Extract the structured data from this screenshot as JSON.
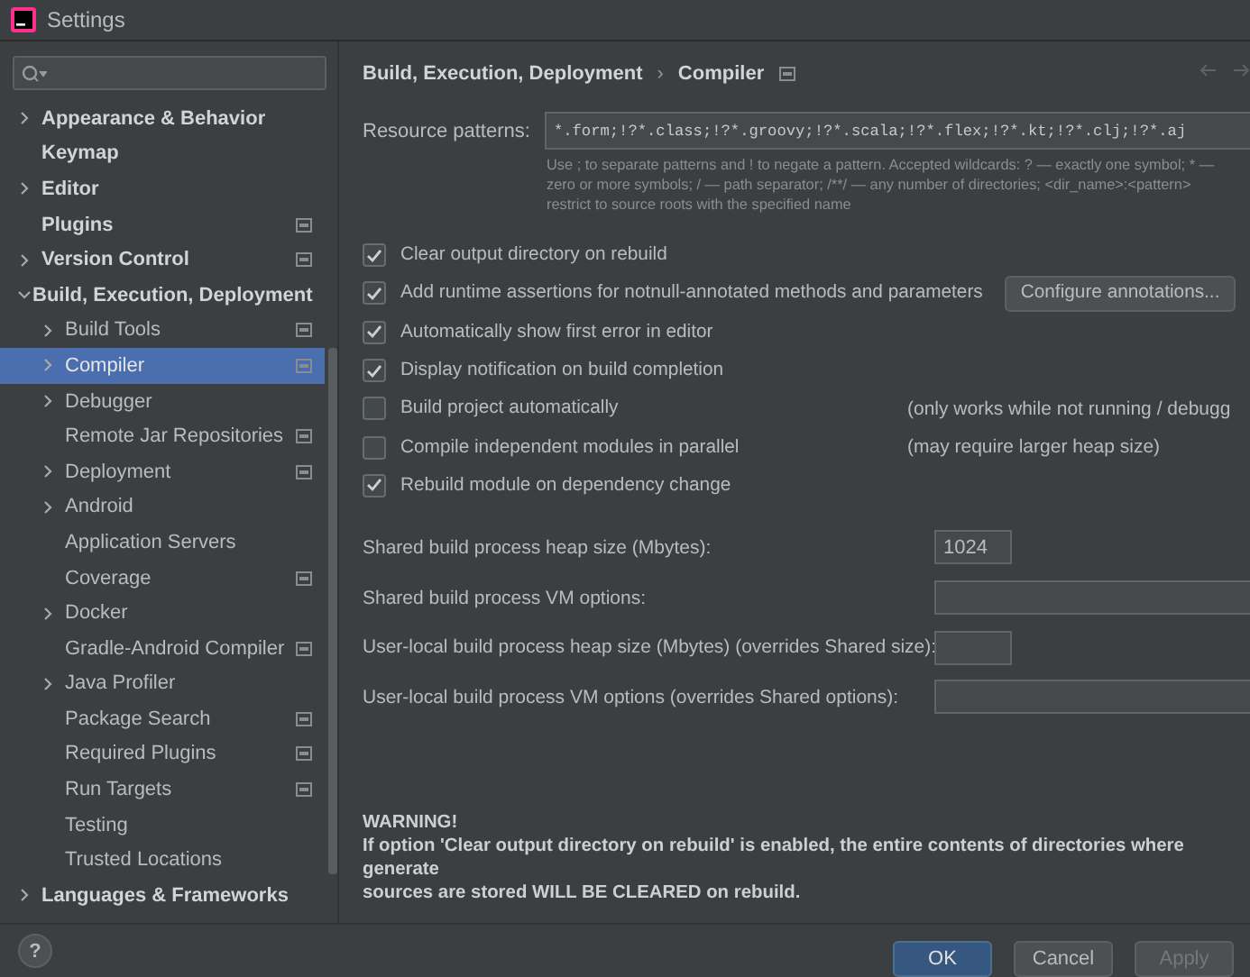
{
  "window": {
    "title": "Settings"
  },
  "sidebar": {
    "items": [
      {
        "label": "Appearance & Behavior",
        "kind": "group",
        "expanded": false,
        "selected": false,
        "scoped": false
      },
      {
        "label": "Keymap",
        "kind": "leaf",
        "selected": false,
        "scoped": false
      },
      {
        "label": "Editor",
        "kind": "group",
        "expanded": false,
        "selected": false,
        "scoped": false
      },
      {
        "label": "Plugins",
        "kind": "leaf",
        "selected": false,
        "scoped": true
      },
      {
        "label": "Version Control",
        "kind": "group",
        "expanded": false,
        "selected": false,
        "scoped": true
      },
      {
        "label": "Build, Execution, Deployment",
        "kind": "group",
        "expanded": true,
        "selected": false,
        "scoped": false,
        "children": [
          {
            "label": "Build Tools",
            "kind": "group",
            "expanded": false,
            "selected": false,
            "scoped": true
          },
          {
            "label": "Compiler",
            "kind": "group",
            "expanded": false,
            "selected": true,
            "scoped": true
          },
          {
            "label": "Debugger",
            "kind": "group",
            "expanded": false,
            "selected": false,
            "scoped": false
          },
          {
            "label": "Remote Jar Repositories",
            "kind": "leaf",
            "selected": false,
            "scoped": true
          },
          {
            "label": "Deployment",
            "kind": "group",
            "expanded": false,
            "selected": false,
            "scoped": true
          },
          {
            "label": "Android",
            "kind": "group",
            "expanded": false,
            "selected": false,
            "scoped": false
          },
          {
            "label": "Application Servers",
            "kind": "leaf",
            "selected": false,
            "scoped": false
          },
          {
            "label": "Coverage",
            "kind": "leaf",
            "selected": false,
            "scoped": true
          },
          {
            "label": "Docker",
            "kind": "group",
            "expanded": false,
            "selected": false,
            "scoped": false
          },
          {
            "label": "Gradle-Android Compiler",
            "kind": "leaf",
            "selected": false,
            "scoped": true
          },
          {
            "label": "Java Profiler",
            "kind": "group",
            "expanded": false,
            "selected": false,
            "scoped": false
          },
          {
            "label": "Package Search",
            "kind": "leaf",
            "selected": false,
            "scoped": true
          },
          {
            "label": "Required Plugins",
            "kind": "leaf",
            "selected": false,
            "scoped": true
          },
          {
            "label": "Run Targets",
            "kind": "leaf",
            "selected": false,
            "scoped": true
          },
          {
            "label": "Testing",
            "kind": "leaf",
            "selected": false,
            "scoped": false
          },
          {
            "label": "Trusted Locations",
            "kind": "leaf",
            "selected": false,
            "scoped": false
          }
        ]
      },
      {
        "label": "Languages & Frameworks",
        "kind": "group",
        "expanded": false,
        "selected": false,
        "scoped": false
      }
    ]
  },
  "breadcrumb": {
    "parent": "Build, Execution, Deployment",
    "separator": "›",
    "current": "Compiler"
  },
  "resource_patterns": {
    "label": "Resource patterns:",
    "value": "*.form;!?*.class;!?*.groovy;!?*.scala;!?*.flex;!?*.kt;!?*.clj;!?*.aj",
    "hint": [
      "Use ; to separate patterns and ! to negate a pattern. Accepted wildcards: ? — exactly one symbol; * —",
      "zero or more symbols; / — path separator; /**/ — any number of directories; <dir_name>:<pattern>",
      "restrict to source roots with the specified name"
    ]
  },
  "options": [
    {
      "label": "Clear output directory on rebuild",
      "checked": true
    },
    {
      "label": "Add runtime assertions for notnull-annotated methods and parameters",
      "checked": true,
      "button": "Configure annotations..."
    },
    {
      "label": "Automatically show first error in editor",
      "checked": true
    },
    {
      "label": "Display notification on build completion",
      "checked": true
    },
    {
      "label": "Build project automatically",
      "checked": false,
      "note": "(only works while not running / debugg"
    },
    {
      "label": "Compile independent modules in parallel",
      "checked": false,
      "note": "(may require larger heap size)"
    },
    {
      "label": "Rebuild module on dependency change",
      "checked": true
    }
  ],
  "fields": [
    {
      "label": "Shared build process heap size (Mbytes):",
      "value": "1024",
      "kind": "short"
    },
    {
      "label": "Shared build process VM options:",
      "kind": "long"
    },
    {
      "label": "User-local build process heap size (Mbytes) (overrides Shared size):",
      "kind": "short"
    },
    {
      "label": "User-local build process VM options (overrides Shared options):",
      "kind": "long"
    }
  ],
  "warning": {
    "title": "WARNING!",
    "text": "If option 'Clear output directory on rebuild' is enabled, the entire contents of directories where generate",
    "text_2": "sources are stored WILL BE CLEARED on rebuild."
  },
  "footer": {
    "help": "?",
    "buttons": [
      {
        "label": "OK",
        "primary": true,
        "disabled": false
      },
      {
        "label": "Cancel",
        "primary": false,
        "disabled": false
      },
      {
        "label": "Apply",
        "primary": false,
        "disabled": true
      }
    ]
  }
}
